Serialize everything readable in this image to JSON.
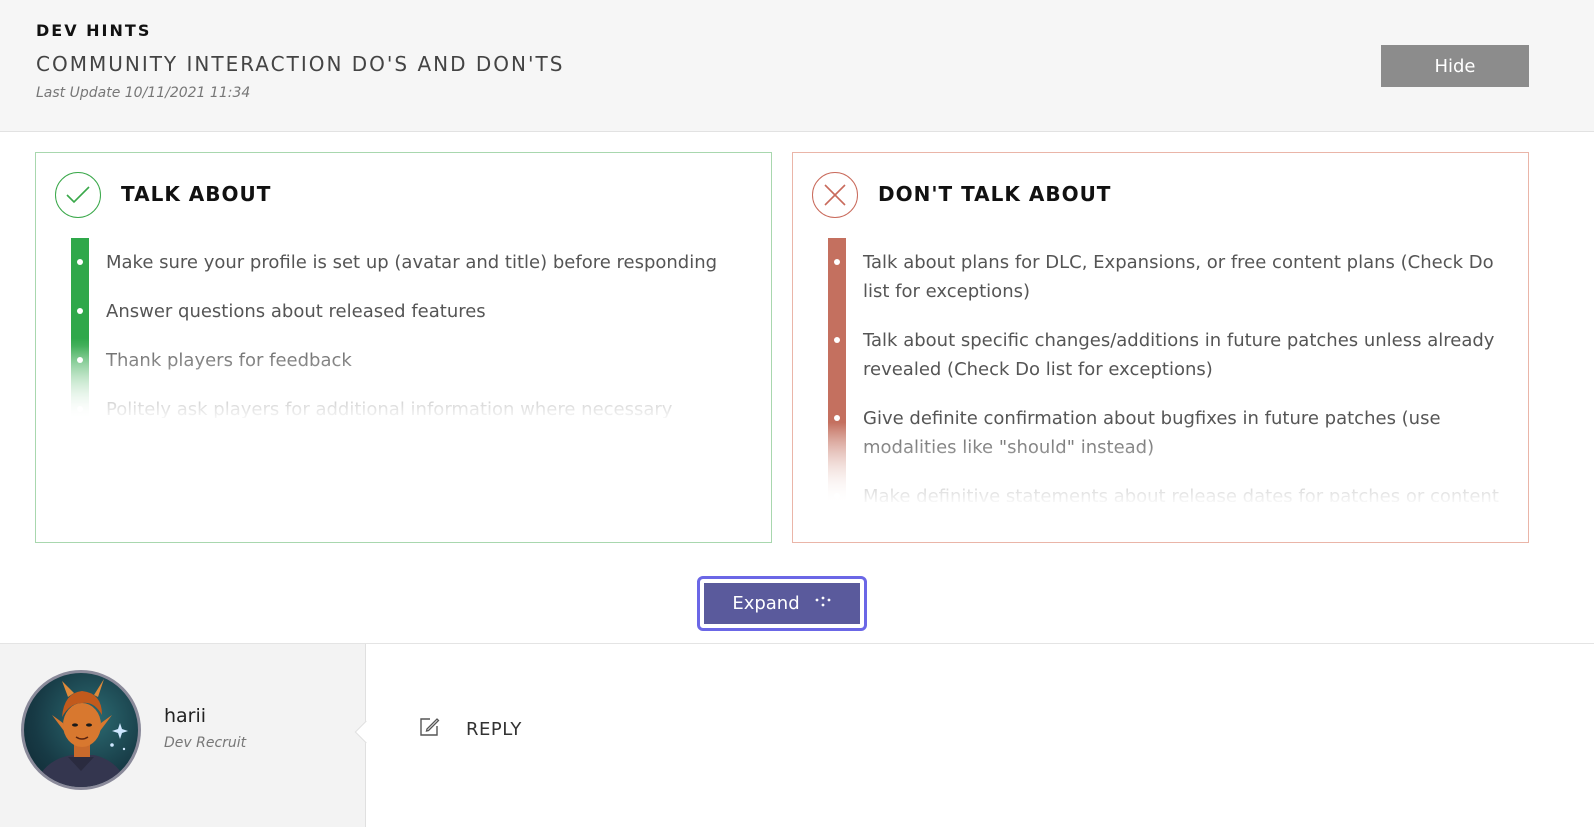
{
  "header": {
    "eyebrow": "DEV HINTS",
    "title": "COMMUNITY INTERACTION DO'S AND DON'TS",
    "last_update": "Last Update 10/11/2021 11:34",
    "hide_label": "Hide"
  },
  "do_panel": {
    "title": "TALK ABOUT",
    "icon": "check-icon",
    "accent": "#2fa84a",
    "items": [
      "Make sure your profile is set up (avatar and title) before responding",
      "Answer questions about released features",
      "Thank players for feedback",
      "Politely ask players for additional information where necessary"
    ]
  },
  "dont_panel": {
    "title": "DON'T TALK ABOUT",
    "icon": "x-icon",
    "accent": "#c4705f",
    "items": [
      "Talk about plans for DLC, Expansions, or free content plans (Check Do list for exceptions)",
      "Talk about specific changes/additions in future patches unless already revealed (Check Do list for exceptions)",
      "Give definite confirmation about bugfixes in future patches (use modalities like \"should\" instead)",
      "Make definitive statements about release dates for patches or content"
    ]
  },
  "expand": {
    "label": "Expand",
    "icon": "dots-icon",
    "focus_color": "#6b67e6"
  },
  "user": {
    "name": "harii",
    "title": "Dev Recruit",
    "avatar": "avatar-image"
  },
  "reply": {
    "label": "REPLY",
    "icon": "edit-icon"
  }
}
